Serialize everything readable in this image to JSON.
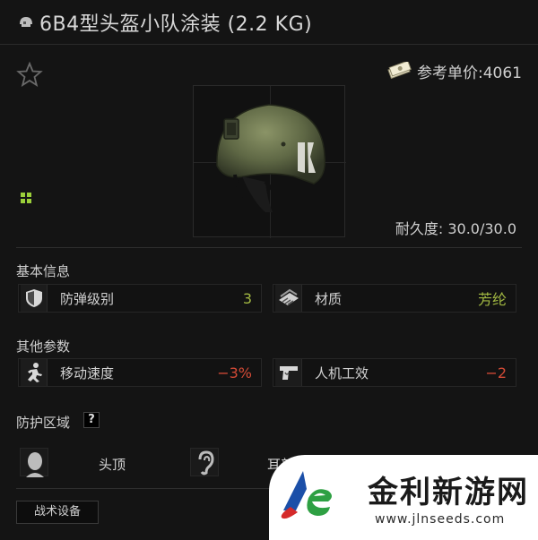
{
  "title": "6B4型头盔小队涂装 (2.2 KG)",
  "price": {
    "label": "参考单价",
    "value": "4061",
    "text": "参考单价:4061"
  },
  "durability": {
    "text": "耐久度: 30.0/30.0"
  },
  "basic_info": {
    "heading": "基本信息",
    "stats": [
      {
        "label": "防弹级别",
        "value": "3",
        "icon": "shield-icon"
      },
      {
        "label": "材质",
        "value": "芳纶",
        "icon": "fabric-icon"
      }
    ]
  },
  "other_params": {
    "heading": "其他参数",
    "stats": [
      {
        "label": "移动速度",
        "value": "−3%",
        "icon": "running-icon"
      },
      {
        "label": "人机工效",
        "value": "−2",
        "icon": "pistol-icon"
      }
    ]
  },
  "protection": {
    "heading": "防护区域",
    "help": "?",
    "zones": [
      {
        "label": "头顶",
        "icon": "head-icon"
      },
      {
        "label": "耳部",
        "icon": "ear-icon"
      }
    ]
  },
  "tabs": {
    "tactical": "战术设备"
  },
  "watermark": {
    "name": "金利新游网",
    "url": "www.jlnseeds.com"
  },
  "colors": {
    "accent_green": "#a2b842",
    "accent_red": "#d34a36",
    "background": "#141414"
  }
}
